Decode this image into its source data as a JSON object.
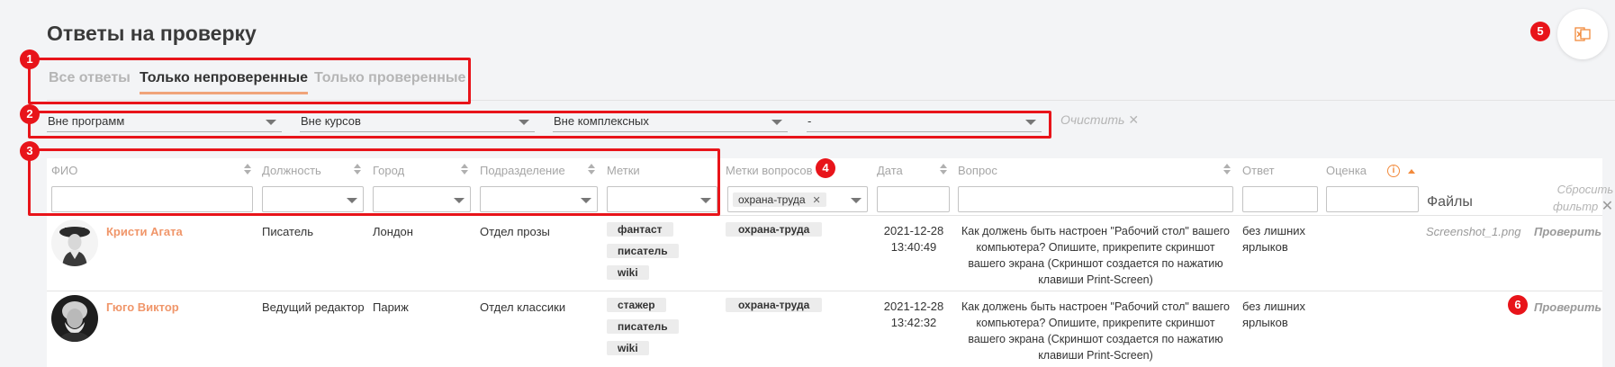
{
  "page": {
    "title": "Ответы на проверку",
    "tabs": [
      {
        "label": "Все ответы",
        "active": false
      },
      {
        "label": "Только непроверенные",
        "active": true
      },
      {
        "label": "Только проверенные",
        "active": false
      }
    ]
  },
  "filters": {
    "program": "Вне программ",
    "course": "Вне курсов",
    "complex": "Вне комплексных",
    "fourth": "-",
    "clear_label": "Очистить",
    "clear_icon": "close-icon"
  },
  "table": {
    "columns": {
      "fio": "ФИО",
      "position": "Должность",
      "city": "Город",
      "department": "Подразделение",
      "tags": "Метки",
      "question_tags": "Метки вопросов",
      "date": "Дата",
      "question": "Вопрос",
      "answer": "Ответ",
      "grade": "Оценка",
      "files": "Файлы"
    },
    "reset_filter": {
      "line1": "Сбросить",
      "line2": "фильтр"
    },
    "question_tag_filter_value": "охрана-труда",
    "rows": [
      {
        "name": "Кристи Агата",
        "position": "Писатель",
        "city": "Лондон",
        "department": "Отдел прозы",
        "tags": [
          "фантаст",
          "писатель",
          "wiki"
        ],
        "question_tag": "охрана-труда",
        "date": "2021-12-28",
        "time": "13:40:49",
        "question": "Как должень быть настроен \"Рабочий стол\" вашего компьютера? Опишите, прикрепите скриншот вашего экрана (Скриншот создается по нажатию клавиши Print-Screen)",
        "answer": "без лишних ярлыков",
        "file": "Screenshot_1.png",
        "action": "Проверить"
      },
      {
        "name": "Гюго Виктор",
        "position": "Ведущий редактор",
        "city": "Париж",
        "department": "Отдел классики",
        "tags": [
          "стажер",
          "писатель",
          "wiki"
        ],
        "question_tag": "охрана-труда",
        "date": "2021-12-28",
        "time": "13:42:32",
        "question": "Как должень быть настроен \"Рабочий стол\" вашего компьютера? Опишите, прикрепите скриншот вашего экрана (Скриншот создается по нажатию клавиши Print-Screen)",
        "answer": "без лишних ярлыков",
        "file": "",
        "action": "Проверить"
      }
    ]
  },
  "annotations": [
    "1",
    "2",
    "3",
    "4",
    "5",
    "6"
  ],
  "colors": {
    "accent": "#f0966a",
    "annotation_red": "#e8141a",
    "excel_orange": "#f28a3c"
  },
  "icons": {
    "export": "excel-export-icon",
    "info": "info-icon",
    "sort": "sort-icon"
  }
}
